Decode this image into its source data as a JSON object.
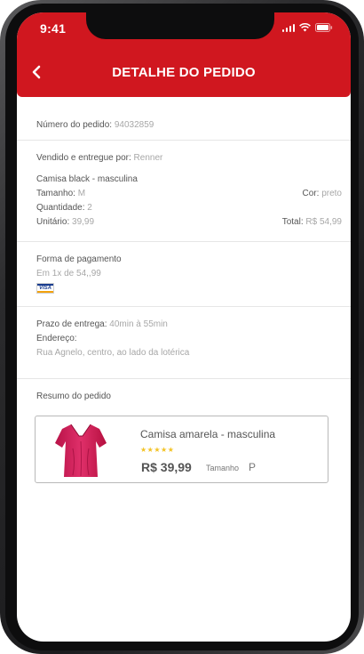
{
  "status_bar": {
    "time": "9:41"
  },
  "header": {
    "title": "DETALHE DO PEDIDO"
  },
  "order": {
    "number_label": "Número do pedido:",
    "number": "94032859"
  },
  "seller": {
    "label": "Vendido e entregue por:",
    "name": "Renner",
    "item_name": "Camisa black - masculina",
    "size_label": "Tamanho:",
    "size": "M",
    "color_label": "Cor:",
    "color": "preto",
    "quantity_label": "Quantidade:",
    "quantity": "2",
    "unit_label": "Unitário:",
    "unit_price": "39,99",
    "total_label": "Total:",
    "total": "R$ 54,99"
  },
  "payment": {
    "label": "Forma de pagamento",
    "installments": "Em 1x de 54,,99",
    "card_brand": "VISA"
  },
  "delivery": {
    "deadline_label": "Prazo de entrega:",
    "deadline": "40min à 55min",
    "address_label": "Endereço:",
    "address": "Rua Agnelo, centro, ao lado da lotérica"
  },
  "summary": {
    "label": "Resumo do pedido",
    "product": {
      "name": "Camisa amarela  - masculina",
      "rating": 5,
      "stars": "★★★★★",
      "price": "R$ 39,99",
      "size_label": "Tamanho",
      "size": "P",
      "image_icon": "pink-shirt-image"
    }
  },
  "colors": {
    "brand_red": "#d0171f",
    "text": "#555555",
    "muted": "#a7a7a7",
    "star": "#f3c325"
  }
}
